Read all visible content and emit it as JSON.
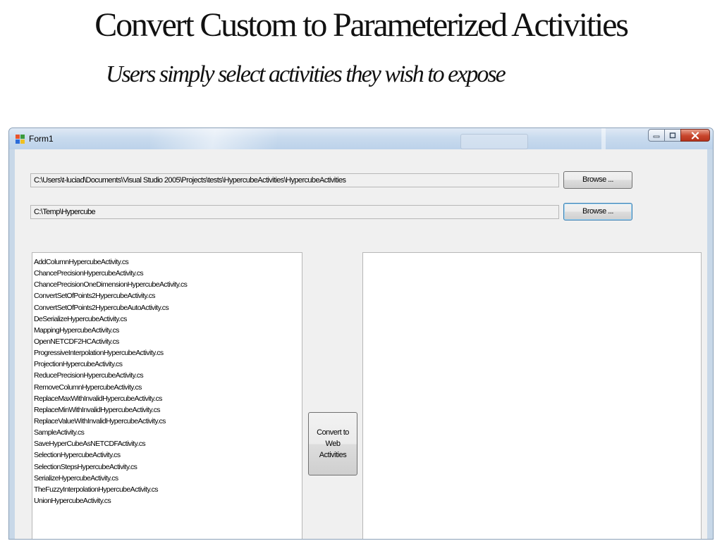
{
  "slide": {
    "title": "Convert Custom to Parameterized Activities",
    "subtitle": "Users simply select activities they wish to expose"
  },
  "window": {
    "title": "Form1",
    "icon": "winforms-app-icon"
  },
  "form": {
    "source_path": "C:\\Users\\t-luciad\\Documents\\Visual Studio 2005\\Projects\\tests\\HypercubeActivities\\HypercubeActivities",
    "output_path": "C:\\Temp\\Hypercube",
    "browse_label_1": "Browse ...",
    "browse_label_2": "Browse ...",
    "convert_label": "Convert to Web Activities"
  },
  "activities": [
    "AddColumnHypercubeActivity.cs",
    "ChancePrecisionHypercubeActivity.cs",
    "ChancePrecisionOneDimensionHypercubeActivity.cs",
    "ConvertSetOfPoints2HypercubeActivity.cs",
    "ConvertSetOfPoints2HypercubeAutoActivity.cs",
    "DeSerializeHypercubeActivity.cs",
    "MappingHypercubeActivity.cs",
    "OpenNETCDF2HCActivity.cs",
    "ProgressiveInterpolationHypercubeActivity.cs",
    "ProjectionHypercubeActivity.cs",
    "ReducePrecisionHypercubeActivity.cs",
    "RemoveColumnHypercubeActivity.cs",
    "ReplaceMaxWithInvalidHypercubeActivity.cs",
    "ReplaceMinWithInvalidHypercubeActivity.cs",
    "ReplaceValueWithInvalidHypercubeActivity.cs",
    "SampleActivity.cs",
    "SaveHyperCubeAsNETCDFActivity.cs",
    "SelectionHypercubeActivity.cs",
    "SelectionStepsHypercubeActivity.cs",
    "SerializeHypercubeActivity.cs",
    "TheFuzzyInterpolationHypercubeActivity.cs",
    "UnionHypercubeActivity.cs"
  ],
  "colors": {
    "close_button": "#c8452c",
    "title_bar": "#c9dbee",
    "client_area": "#f0f0f0"
  }
}
